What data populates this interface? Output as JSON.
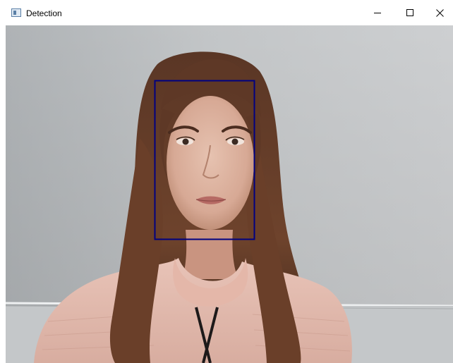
{
  "window": {
    "title": "Detection",
    "app_icon": "window-icon",
    "controls": [
      "minimize-icon",
      "maximize-icon",
      "close-icon"
    ]
  },
  "viewport": {
    "content": "webcam-frame",
    "detection_box_color": "#000080"
  }
}
